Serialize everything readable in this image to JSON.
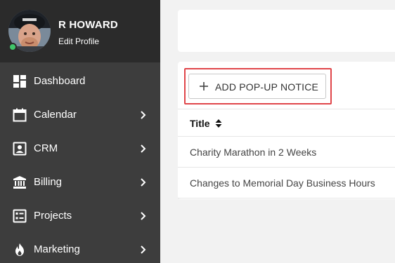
{
  "profile": {
    "name": "R HOWARD",
    "edit_link": "Edit Profile"
  },
  "sidebar": {
    "items": [
      {
        "label": "Dashboard",
        "icon": "dashboard-icon",
        "has_submenu": false
      },
      {
        "label": "Calendar",
        "icon": "calendar-icon",
        "has_submenu": true
      },
      {
        "label": "CRM",
        "icon": "contact-card-icon",
        "has_submenu": true
      },
      {
        "label": "Billing",
        "icon": "bank-icon",
        "has_submenu": true
      },
      {
        "label": "Projects",
        "icon": "checklist-icon",
        "has_submenu": true
      },
      {
        "label": "Marketing",
        "icon": "flame-icon",
        "has_submenu": true
      }
    ]
  },
  "main": {
    "add_button_label": "ADD POP-UP NOTICE",
    "table": {
      "columns": [
        "Title"
      ],
      "rows": [
        {
          "title": "Charity Marathon in 2 Weeks"
        },
        {
          "title": "Changes to Memorial Day Business Hours"
        }
      ]
    }
  },
  "colors": {
    "sidebar_bg": "#3d3d3d",
    "profile_bg": "#2b2b2b",
    "status_online": "#3fc66a",
    "highlight": "#e0464a"
  }
}
